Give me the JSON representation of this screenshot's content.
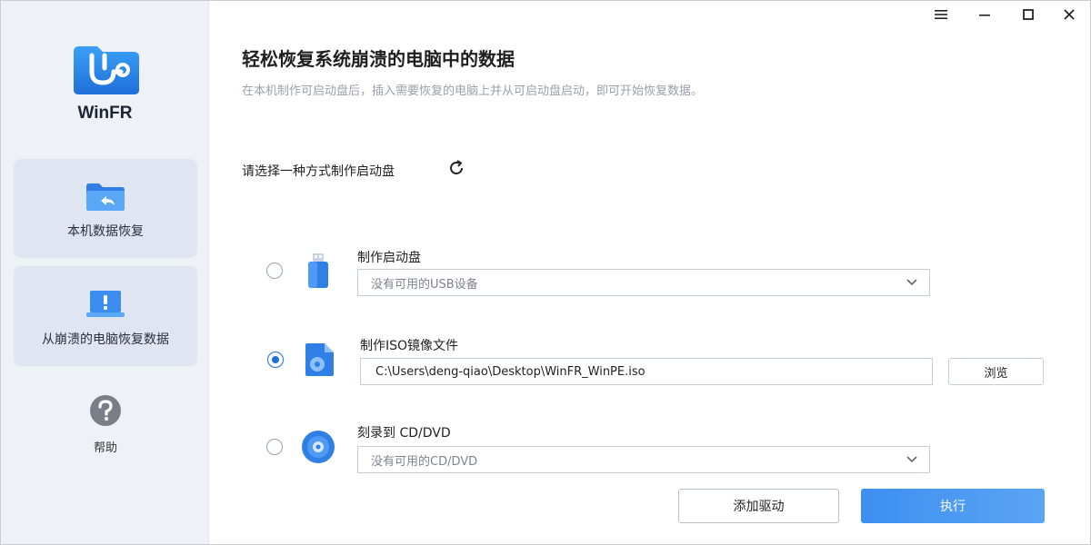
{
  "app": {
    "name": "WinFR"
  },
  "sidebar": {
    "items": [
      {
        "label": "本机数据恢复",
        "icon": "folder-back-icon"
      },
      {
        "label": "从崩溃的电脑恢复数据",
        "icon": "laptop-alert-icon"
      }
    ],
    "help_label": "帮助"
  },
  "main": {
    "title": "轻松恢复系统崩溃的电脑中的数据",
    "subtitle": "在本机制作可启动盘后，插入需要恢复的电脑上并从可启动盘启动，即可开始恢复数据。",
    "select_prompt": "请选择一种方式制作启动盘",
    "options": [
      {
        "label": "制作启动盘",
        "value": "没有可用的USB设备",
        "checked": false,
        "icon": "usb-drive-icon"
      },
      {
        "label": "制作ISO镜像文件",
        "value": "C:\\Users\\deng-qiao\\Desktop\\WinFR_WinPE.iso",
        "checked": true,
        "icon": "iso-file-icon"
      },
      {
        "label": "刻录到 CD/DVD",
        "value": "没有可用的CD/DVD",
        "checked": false,
        "icon": "disc-icon"
      }
    ],
    "browse_label": "浏览",
    "add_driver_label": "添加驱动",
    "execute_label": "执行"
  },
  "colors": {
    "accent": "#1f6fd9",
    "execute_button": "#4a98f2",
    "sidebar_bg": "#eef1f6",
    "card_bg": "#dfe6f2"
  }
}
